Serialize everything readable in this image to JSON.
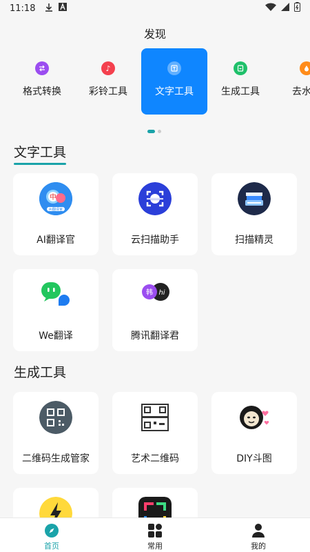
{
  "status_bar": {
    "time": "11:18"
  },
  "header": {
    "title": "发现"
  },
  "tabs": [
    {
      "label": "格式转换",
      "icon": "format-convert-icon",
      "color": "#9b4df0"
    },
    {
      "label": "彩铃工具",
      "icon": "ringtone-icon",
      "color": "#f4404e"
    },
    {
      "label": "文字工具",
      "icon": "text-tool-icon",
      "color": "#ffffff",
      "active": true
    },
    {
      "label": "生成工具",
      "icon": "generate-icon",
      "color": "#1fc06a"
    },
    {
      "label": "去水印",
      "icon": "watermark-icon",
      "color": "#ff8c1a"
    }
  ],
  "sections": [
    {
      "title": "文字工具",
      "items": [
        {
          "label": "AI翻译官",
          "icon": "ai-translator-icon",
          "icon_text": "中",
          "icon_subtext": "AI翻译官"
        },
        {
          "label": "云扫描助手",
          "icon": "cloud-scan-icon"
        },
        {
          "label": "扫描精灵",
          "icon": "scanner-icon"
        },
        {
          "label": "We翻译",
          "icon": "we-translate-icon"
        },
        {
          "label": "腾讯翻译君",
          "icon": "tencent-translate-icon",
          "icon_text": "韩",
          "icon_text2": "hi"
        }
      ]
    },
    {
      "title": "生成工具",
      "items": [
        {
          "label": "二维码生成管家",
          "icon": "qr-manager-icon"
        },
        {
          "label": "艺术二维码",
          "icon": "art-qr-icon"
        },
        {
          "label": "DIY斗图",
          "icon": "diy-meme-icon"
        },
        {
          "label": "",
          "icon": "lightning-app-icon"
        },
        {
          "label": "",
          "icon": "frame-app-icon"
        }
      ]
    }
  ],
  "bottom_nav": [
    {
      "label": "首页",
      "icon": "compass-icon",
      "active": true
    },
    {
      "label": "常用",
      "icon": "grid-icon"
    },
    {
      "label": "我的",
      "icon": "user-icon"
    }
  ],
  "colors": {
    "accent": "#1aa3a9",
    "active_tab": "#0f86ff"
  }
}
